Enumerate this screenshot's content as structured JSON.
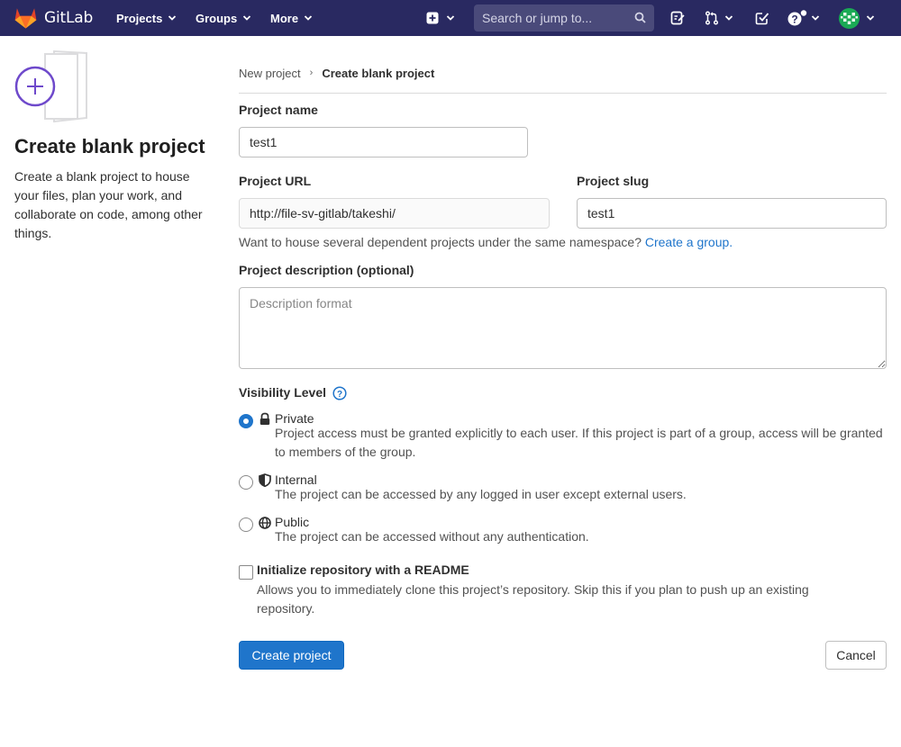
{
  "navbar": {
    "brand": "GitLab",
    "menus": [
      {
        "label": "Projects"
      },
      {
        "label": "Groups"
      },
      {
        "label": "More"
      }
    ],
    "search_placeholder": "Search or jump to...",
    "icons": [
      "plus-square-icon",
      "chevron-down-icon",
      "search-icon",
      "issues-icon",
      "merge-request-icon",
      "todo-icon",
      "help-icon",
      "avatar"
    ]
  },
  "sidebar": {
    "title": "Create blank project",
    "description": "Create a blank project to house your files, plan your work, and collaborate on code, among other things."
  },
  "breadcrumb": {
    "parent": "New project",
    "current": "Create blank project"
  },
  "form": {
    "project_name_label": "Project name",
    "project_name_value": "test1",
    "project_url_label": "Project URL",
    "project_url_value": "http://file-sv-gitlab/takeshi/",
    "project_slug_label": "Project slug",
    "project_slug_value": "test1",
    "namespace_help": "Want to house several dependent projects under the same namespace?",
    "namespace_link": "Create a group.",
    "description_label": "Project description (optional)",
    "description_placeholder": "Description format",
    "visibility_label": "Visibility Level",
    "visibility_options": [
      {
        "name": "Private",
        "description": "Project access must be granted explicitly to each user. If this project is part of a group, access will be granted to members of the group.",
        "selected": true,
        "icon": "lock-icon"
      },
      {
        "name": "Internal",
        "description": "The project can be accessed by any logged in user except external users.",
        "selected": false,
        "icon": "shield-icon"
      },
      {
        "name": "Public",
        "description": "The project can be accessed without any authentication.",
        "selected": false,
        "icon": "globe-icon"
      }
    ],
    "readme_label": "Initialize repository with a README",
    "readme_description": "Allows you to immediately clone this project’s repository. Skip this if you plan to push up an existing repository.",
    "readme_checked": false,
    "submit_label": "Create project",
    "cancel_label": "Cancel"
  },
  "colors": {
    "navbar_bg": "#292961",
    "primary": "#1f75cb",
    "link": "#1f75cb",
    "illustration_accent": "#6e49cb"
  }
}
